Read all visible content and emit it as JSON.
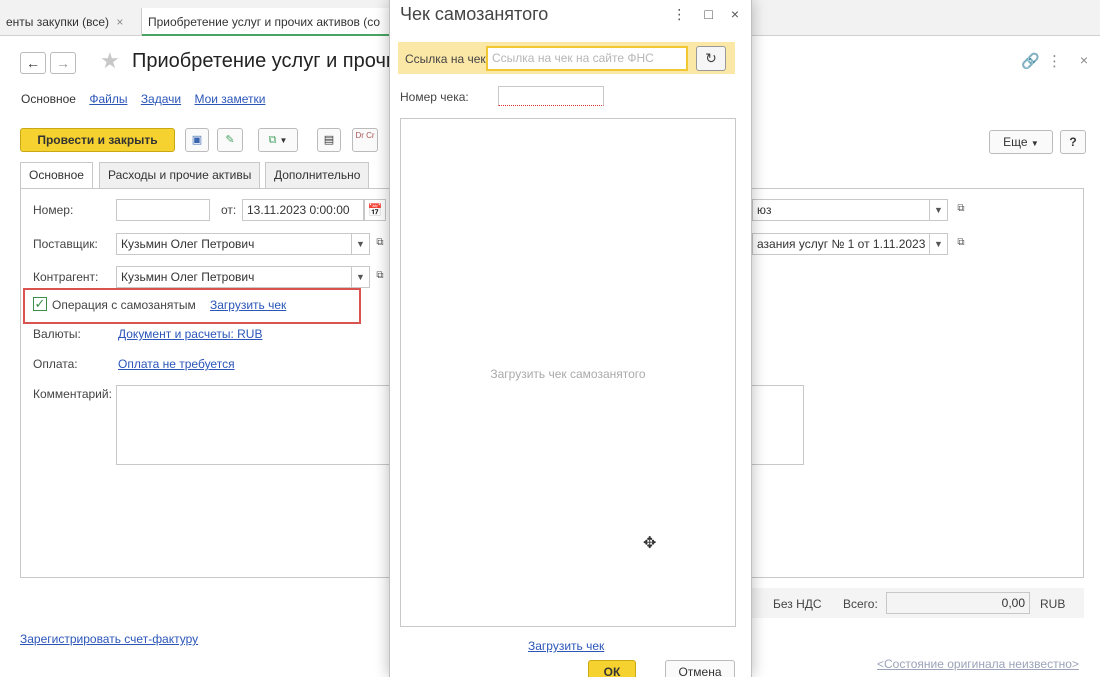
{
  "tabs": [
    {
      "label": "енты закупки (все)",
      "close": "×"
    },
    {
      "label": "Приобретение услуг и прочих активов (со"
    }
  ],
  "form": {
    "title": "Приобретение услуг и прочих а",
    "nav": [
      "Основное",
      "Файлы",
      "Задачи",
      "Мои заметки"
    ],
    "toolbar": {
      "post_close_label": "Провести и закрыть",
      "more_label": "Еще",
      "help_label": "?",
      "dtct_label": "Dr Cr"
    },
    "field_tabs": [
      "Основное",
      "Расходы и прочие активы",
      "Дополнительно"
    ],
    "number": {
      "label": "Номер:",
      "value": ""
    },
    "date": {
      "label": "от:",
      "value": "13.11.2023  0:00:00"
    },
    "supplier": {
      "label": "Поставщик:",
      "value": "Кузьмин Олег Петрович"
    },
    "counterparty": {
      "label": "Контрагент:",
      "value": "Кузьмин Олег Петрович"
    },
    "self_employed": {
      "checked": true,
      "label": "Операция с самозанятым",
      "link": "Загрузить чек"
    },
    "currency": {
      "label": "Валюты:",
      "value": "Документ и расчеты: RUB"
    },
    "payment": {
      "label": "Оплата:",
      "value": "Оплата не требуется"
    },
    "comment": {
      "label": "Комментарий:",
      "value": ""
    },
    "right_field_1": "юз",
    "right_field_2": "азания услуг № 1 от 1.11.2023",
    "totals": {
      "vat_label": "Без НДС",
      "total_label": "Всего:",
      "total_value": "0,00",
      "currency": "RUB"
    },
    "invoice_link": "Зарегистрировать счет-фактуру",
    "original_status": "<Состояние оригинала неизвестно>"
  },
  "modal": {
    "title": "Чек самозанятого",
    "url_label": "Ссылка на чек:",
    "url_placeholder": "Ссылка на чек на сайте ФНС",
    "receipt_number_label": "Номер чека:",
    "receipt_number_value": "",
    "drop_area_text": "Загрузить чек самозанятого",
    "upload_link": "Загрузить чек",
    "ok_label": "ОК",
    "cancel_label": "Отмена"
  },
  "colors": {
    "accent_yellow": "#f5d22f",
    "link_blue": "#2b56b8",
    "highlight_red": "#d9534f",
    "tab_green": "#4aa564"
  },
  "icons": [
    "back-arrow-icon",
    "forward-arrow-icon",
    "star-icon",
    "save-icon",
    "report-icon",
    "copy-icon",
    "list-icon",
    "dtct-icon",
    "calendar-icon",
    "chain-link-icon",
    "kebab-menu-icon",
    "close-icon",
    "maximize-icon",
    "refresh-link-icon",
    "cursor-icon"
  ]
}
